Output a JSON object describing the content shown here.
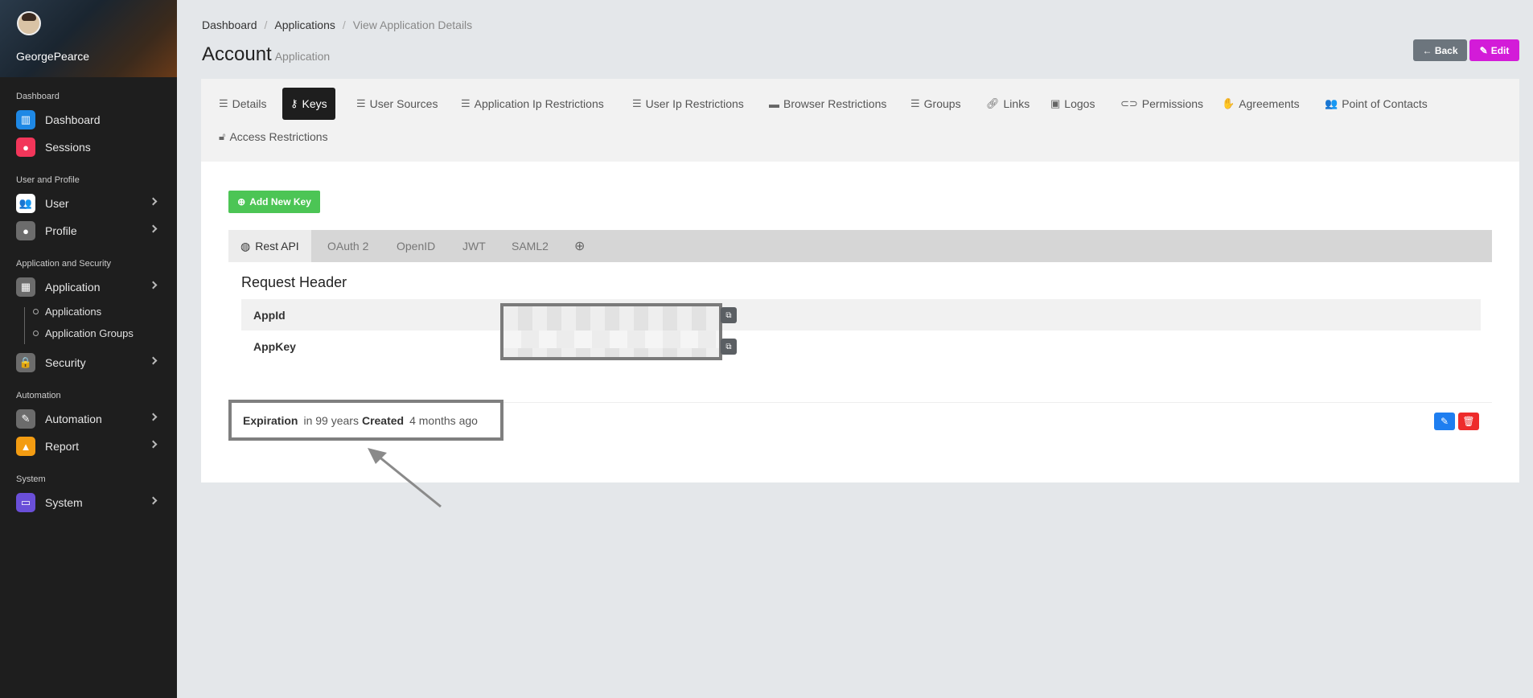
{
  "sidebar": {
    "username": "GeorgePearce",
    "sections": {
      "dashboard": "Dashboard",
      "user_profile": "User and Profile",
      "app_security": "Application and Security",
      "automation": "Automation",
      "system": "System"
    },
    "items": {
      "dashboard": "Dashboard",
      "sessions": "Sessions",
      "user": "User",
      "profile": "Profile",
      "application": "Application",
      "applications": "Applications",
      "application_groups": "Application Groups",
      "security": "Security",
      "automation": "Automation",
      "report": "Report",
      "system": "System"
    },
    "colors": {
      "dashboard": "#1e88e5",
      "sessions": "#f2365a",
      "user": "#ffffff",
      "profile": "#6c6c6c",
      "application": "#6c6c6c",
      "security": "#6c6c6c",
      "automation": "#6c6c6c",
      "report": "#f39c12",
      "system": "#6a4fd8"
    }
  },
  "breadcrumb": {
    "items": [
      "Dashboard",
      "Applications",
      "View Application Details"
    ]
  },
  "header": {
    "title": "Account",
    "subtitle": "Application",
    "back_label": "← Back",
    "edit_label": "Edit"
  },
  "tabs": [
    "Details",
    "Keys",
    "User Sources",
    "Application Ip Restrictions",
    "User Ip Restrictions",
    "Browser Restrictions",
    "Groups",
    "Links",
    "Logos",
    "Permissions",
    "Agreements",
    "Point of Contacts",
    "Access Restrictions"
  ],
  "active_tab": "Keys",
  "keys": {
    "add_label": "Add New Key",
    "subtabs": [
      "Rest API",
      "OAuth 2",
      "OpenID",
      "JWT",
      "SAML2"
    ],
    "active_subtab": "Rest API",
    "section_title": "Request Header",
    "rows": [
      "AppId",
      "AppKey"
    ],
    "expiration_label": "Expiration",
    "expiration_value": "in 99 years",
    "created_label": "Created",
    "created_value": "4 months ago"
  }
}
